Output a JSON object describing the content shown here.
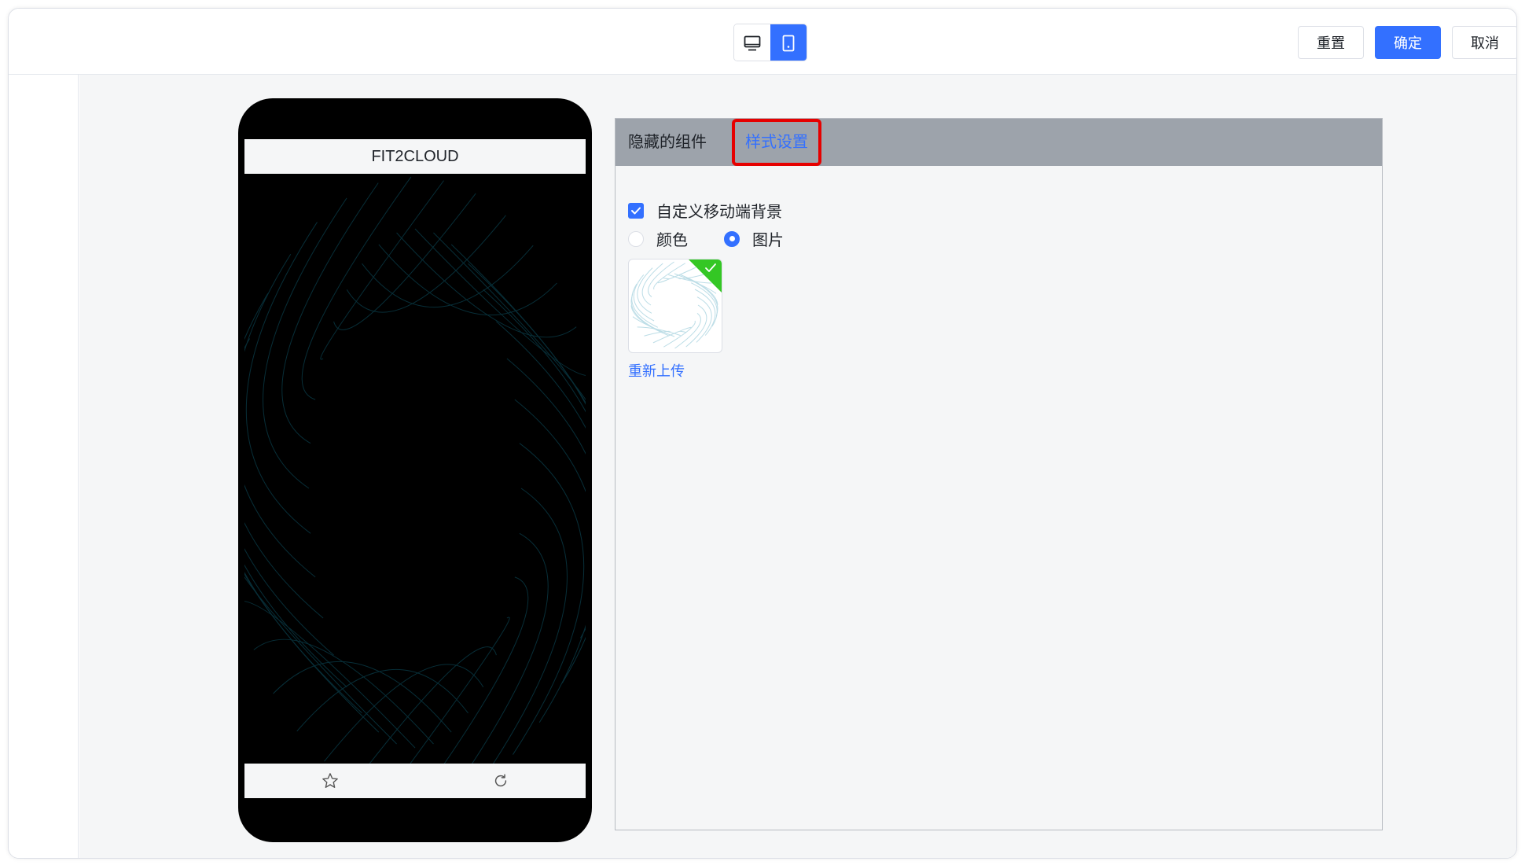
{
  "toolbar": {
    "reset_label": "重置",
    "confirm_label": "确定",
    "cancel_label": "取消",
    "device_options": [
      "desktop-icon",
      "mobile-icon"
    ],
    "active_device": "mobile"
  },
  "preview": {
    "app_title": "FIT2CLOUD",
    "footer_icons": [
      "star-icon",
      "refresh-icon"
    ],
    "background_color": "#000000",
    "wave_color": "#0e5566"
  },
  "panel": {
    "tabs": [
      {
        "label": "隐藏的组件",
        "active": false
      },
      {
        "label": "样式设置",
        "active": true,
        "highlighted": true
      }
    ],
    "custom_bg_label": "自定义移动端背景",
    "custom_bg_checked": true,
    "bg_type_options": [
      {
        "label": "颜色",
        "selected": false
      },
      {
        "label": "图片",
        "selected": true
      }
    ],
    "reupload_label": "重新上传"
  },
  "colors": {
    "accent": "#3370ff",
    "highlight_border": "#e60000",
    "success_badge": "#34c724",
    "tabs_bg": "#9da3ab"
  }
}
